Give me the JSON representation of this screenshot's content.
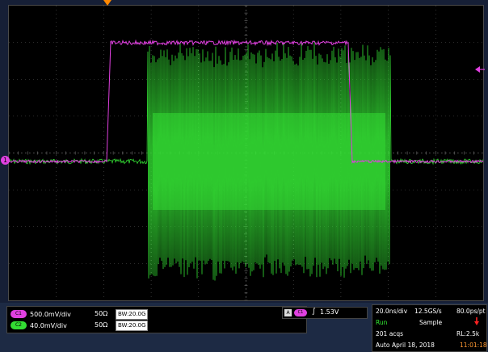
{
  "colors": {
    "ch1": "#e040e0",
    "ch2": "#33ee33",
    "graticule": "#555555",
    "trigger_marker": "#ff8800"
  },
  "channels": [
    {
      "badge": "C1",
      "scale": "500.0mV/div",
      "impedance": "50Ω",
      "bandwidth": "BW:20.0G",
      "color": "#e040e0"
    },
    {
      "badge": "C2",
      "scale": "40.0mV/div",
      "impedance": "50Ω",
      "bandwidth": "BW:20.0G",
      "color": "#33dd33"
    }
  ],
  "trigger": {
    "source_icon": "A",
    "channel_badge": "C1",
    "slope_icon": "rising-edge-icon",
    "level": "1.53V"
  },
  "acquisition": {
    "horizontal_scale": "20.0ns/div",
    "sample_rate": "12.5GS/s",
    "resolution": "80.0ps/pt",
    "run_state": "Run",
    "mode": "Sample",
    "acquisitions": "201 acqs",
    "record_length": "RL:2.5k",
    "trigger_mode": "Auto",
    "date": "April 18, 2018",
    "time": "11:01:18"
  },
  "markers": {
    "ch1_ground_label": "1"
  }
}
